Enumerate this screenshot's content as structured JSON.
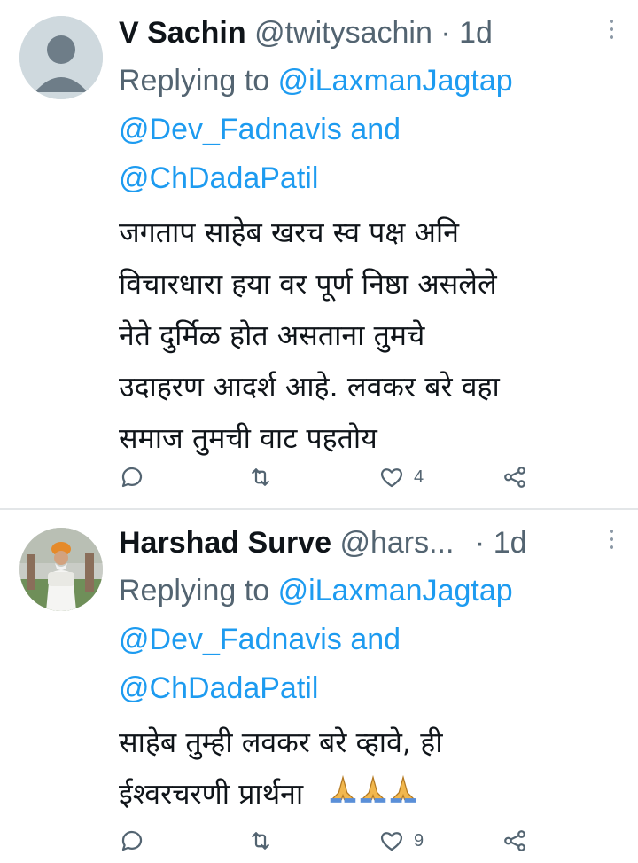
{
  "tweets": [
    {
      "name": "V Sachin",
      "handle": "@twitysachin",
      "separator": "·",
      "time": "1d",
      "replying_label": "Replying to",
      "mention_1": "@iLaxmanJagtap",
      "mention_2": "@Dev_Fadnavis",
      "and_label": "and",
      "mention_3": "@ChDadaPatil",
      "body_lines": [
        "जगताप साहेब खरच स्व पक्ष अनि",
        "विचारधारा हया वर पूर्ण निष्ठा असलेले",
        "नेते दुर्मिळ होत असताना तुमचे",
        "उदाहरण आदर्श आहे. लवकर बरे वहा",
        "समाज तुमची वाट पहतोय"
      ],
      "like_count": "4",
      "avatar": "default-avatar-icon"
    },
    {
      "name": "Harshad Surve",
      "handle": "@hars...",
      "separator": "·",
      "time": "1d",
      "replying_label": "Replying to",
      "mention_1": "@iLaxmanJagtap",
      "mention_2": "@Dev_Fadnavis",
      "and_label": "and",
      "mention_3": "@ChDadaPatil",
      "body_lines": [
        "साहेब तुम्ही लवकर बरे व्हावे, ही",
        "ईश्वरचरणी प्रार्थना"
      ],
      "emoji": "folded-hands-icon x3",
      "like_count": "9",
      "avatar": "profile-photo"
    }
  ],
  "colors": {
    "mention": "#1d9bf0",
    "secondary_text": "#536471",
    "primary_text": "#0f1419",
    "divider": "#e3e6e8"
  }
}
